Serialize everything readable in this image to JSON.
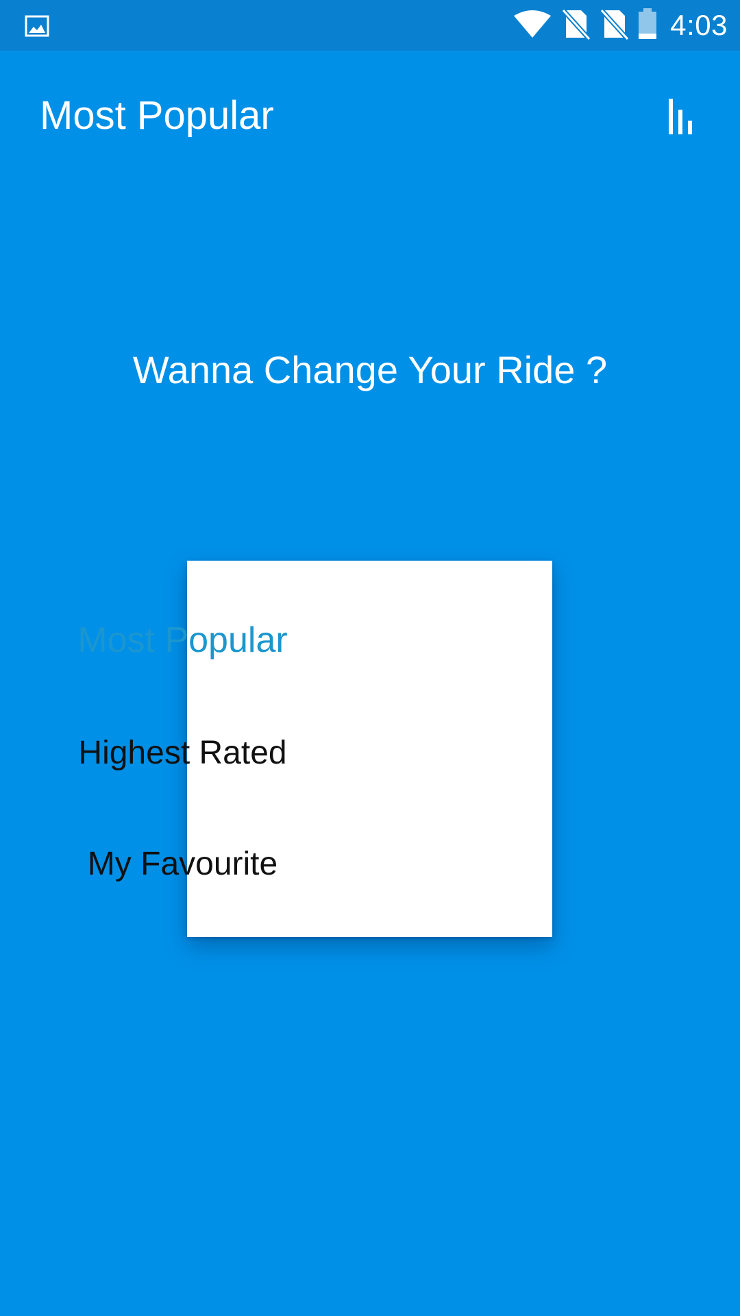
{
  "status_bar": {
    "time": "4:03",
    "left_icon": "image-icon",
    "icons": [
      "wifi-icon",
      "no-sim-icon",
      "no-sim-icon",
      "battery-icon"
    ]
  },
  "app_bar": {
    "title": "Most Popular",
    "sort_icon": "sort-bars-icon"
  },
  "prompt": "Wanna Change Your Ride ?",
  "sort_menu": {
    "items": [
      {
        "label": "Most Popular",
        "selected": true
      },
      {
        "label": "Highest Rated",
        "selected": false
      },
      {
        "label": "My Favourite",
        "selected": false
      }
    ]
  },
  "colors": {
    "background": "#0090e8",
    "status_bar": "#0a80d0",
    "selected_item": "#1b96cf",
    "text_on_primary": "#ffffff"
  }
}
